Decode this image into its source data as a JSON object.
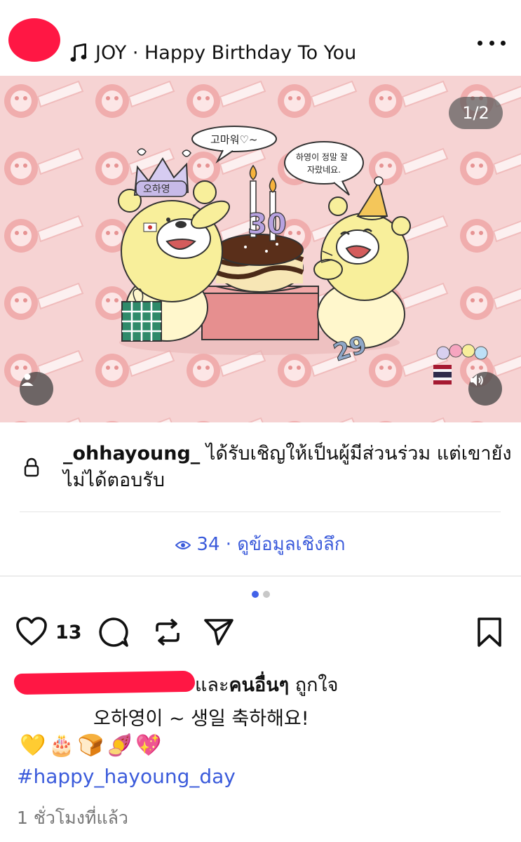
{
  "header": {
    "music_text": "JOY · Happy Birthday To You"
  },
  "media": {
    "counter": "1/2",
    "bubble_left": "고마워♡~",
    "bubble_right_line1": "하영이 정말 잘",
    "bubble_right_line2": "자랐네요.",
    "crown_text": "오하영",
    "cake_numbers": "30",
    "floor_number": "29"
  },
  "invite": {
    "username": "_ohhayoung_",
    "message": " ได้รับเชิญให้เป็นผู้มีส่วนร่วม แต่เขายังไม่ได้ตอบรับ"
  },
  "insights": {
    "text": "34 · ดูข้อมูลเชิงลึก"
  },
  "actions": {
    "like_count": "13"
  },
  "caption": {
    "likes_prefix": "และ",
    "likes_bold": "คนอื่นๆ",
    "likes_suffix": " ถูกใจ",
    "text": "오하영이 ~ 생일 축하해요!",
    "emojis": "💛🎂🍞🍠💖",
    "hashtag": "#happy_hayoung_day",
    "time": "1 ชั่วโมงที่แล้ว"
  },
  "colors": {
    "accent_blue": "#3b5bdb",
    "redaction": "#ff1744",
    "background_pink": "#f6d3d3"
  }
}
